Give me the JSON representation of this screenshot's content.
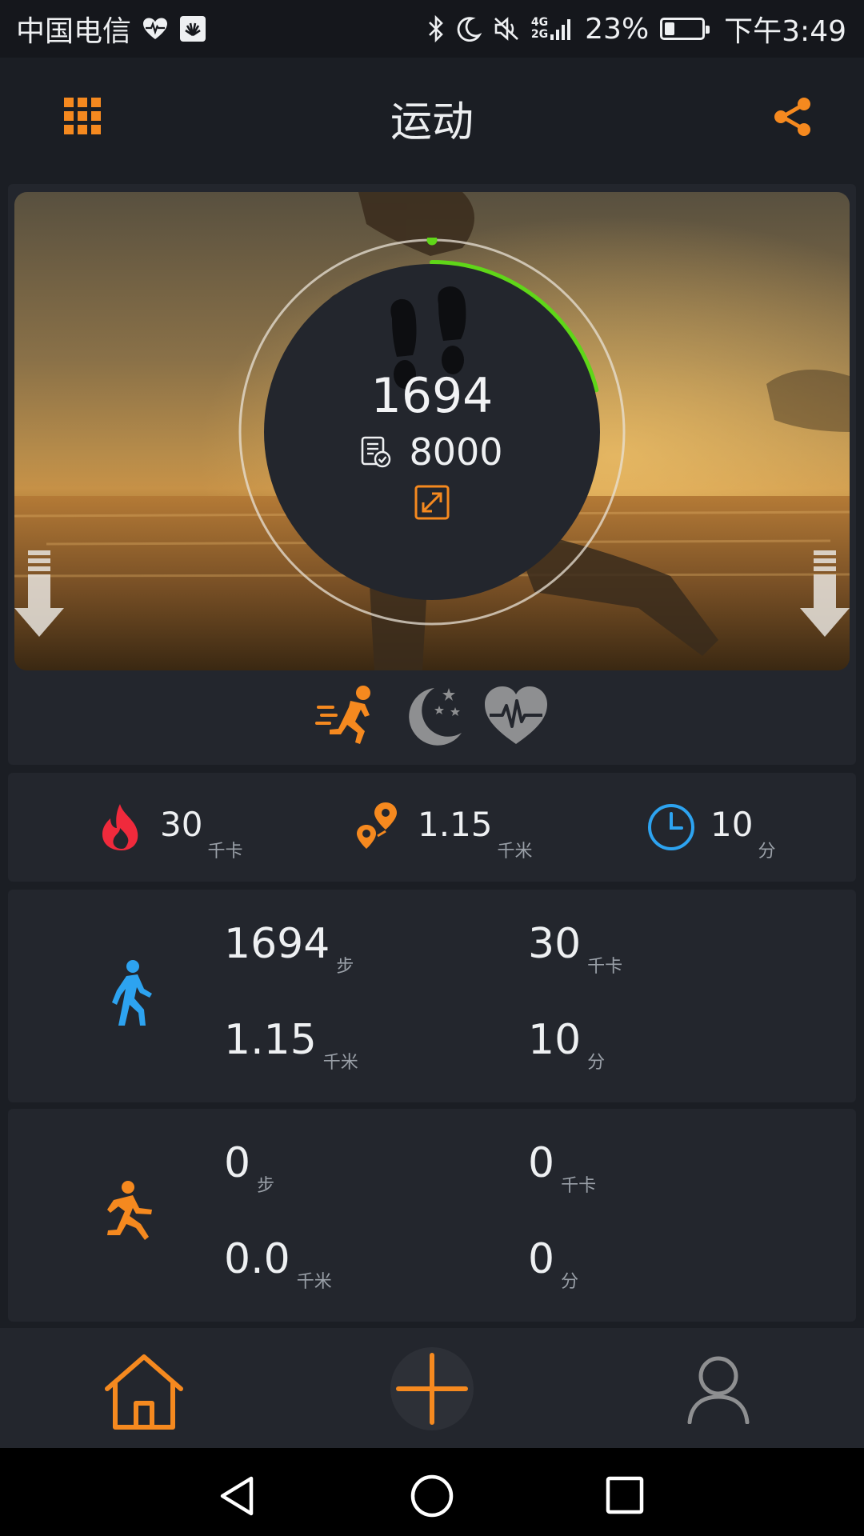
{
  "status_bar": {
    "carrier": "中国电信",
    "network_top": "4G",
    "network_bottom": "2G",
    "battery": "23%",
    "battery_level": 0.23,
    "time": "下午3:49",
    "icons": [
      "heart-rate-icon",
      "huawei-app-icon",
      "bluetooth-icon",
      "moon-icon",
      "mute-icon",
      "signal-icon",
      "battery-icon"
    ]
  },
  "header": {
    "title": "运动",
    "left_icon": "grid-menu-icon",
    "right_icon": "share-icon"
  },
  "hero": {
    "steps": "1694",
    "goal": "8000",
    "progress": 0.21,
    "icons": [
      "footprints-icon",
      "goal-icon",
      "expand-icon",
      "scroll-down-icon"
    ]
  },
  "modes": [
    {
      "name": "running-mode",
      "icon": "running-icon",
      "active": true
    },
    {
      "name": "sleep-mode",
      "icon": "moon-stars-icon",
      "active": false
    },
    {
      "name": "heart-rate-mode",
      "icon": "heart-pulse-icon",
      "active": false
    }
  ],
  "summary": {
    "calories": {
      "value": "30",
      "unit": "千卡"
    },
    "distance": {
      "value": "1.15",
      "unit": "千米"
    },
    "duration": {
      "value": "10",
      "unit": "分"
    }
  },
  "walk": {
    "steps": {
      "value": "1694",
      "unit": "步"
    },
    "calories": {
      "value": "30",
      "unit": "千卡"
    },
    "distance": {
      "value": "1.15",
      "unit": "千米"
    },
    "duration": {
      "value": "10",
      "unit": "分"
    }
  },
  "run": {
    "steps": {
      "value": "0",
      "unit": "步"
    },
    "calories": {
      "value": "0",
      "unit": "千卡"
    },
    "distance": {
      "value": "0.0",
      "unit": "千米"
    },
    "duration": {
      "value": "0",
      "unit": "分"
    }
  },
  "colors": {
    "accent": "#f5891f",
    "progress": "#5fd618",
    "calories": "#f02a3c",
    "time": "#2da3f0",
    "walk": "#2da3f0"
  }
}
